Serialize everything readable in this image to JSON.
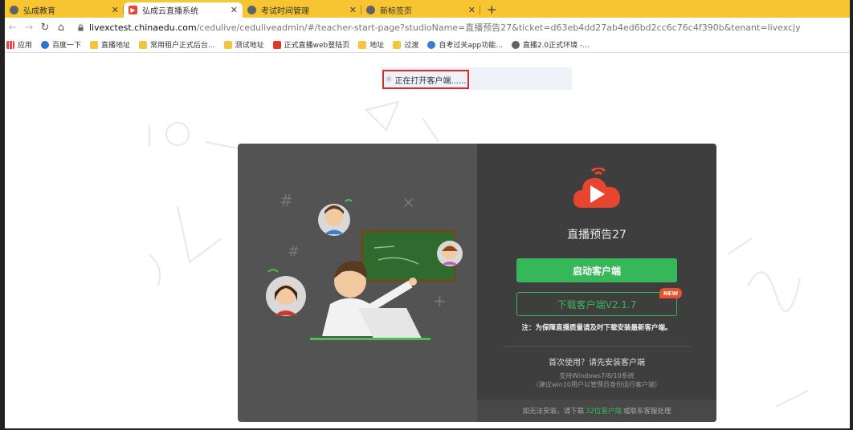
{
  "tabs": [
    {
      "title": "弘成教育",
      "favicon": "globe-icon",
      "active": false
    },
    {
      "title": "弘成云直播系统",
      "favicon": "live-app-icon",
      "active": true
    },
    {
      "title": "考试时间管理",
      "favicon": "globe-icon",
      "active": false
    },
    {
      "title": "新标签页",
      "favicon": "globe-icon",
      "active": false
    }
  ],
  "address": {
    "host": "livexctest.chinaedu.com",
    "path": "/cedulive/ceduliveadmin/#/teacher-start-page?studioName=直播预告27&ticket=d63eb4dd27ab4ed6bd2cc6c76c4f390b&tenant=livexcjy"
  },
  "bookmarks": [
    {
      "label": "应用",
      "icon": "apps-grid-icon"
    },
    {
      "label": "百度一下",
      "icon": "baidu-paw-icon"
    },
    {
      "label": "直播地址",
      "icon": "folder-icon"
    },
    {
      "label": "常用租户正式后台...",
      "icon": "folder-icon"
    },
    {
      "label": "测试地址",
      "icon": "folder-icon"
    },
    {
      "label": "正式直播web登陆页",
      "icon": "live-app-icon"
    },
    {
      "label": "地址",
      "icon": "folder-icon"
    },
    {
      "label": "过渡",
      "icon": "folder-icon"
    },
    {
      "label": "自考过关app功能...",
      "icon": "globe-icon"
    },
    {
      "label": "直播2.0正式环境 -...",
      "icon": "chrome-icon"
    }
  ],
  "status": {
    "text": "正在打开客户端......"
  },
  "dialog": {
    "studio_name": "直播预告27",
    "launch_label": "启动客户端",
    "download_label": "下载客户端V2.1.7",
    "new_badge": "NEW",
    "note": "注：为保障直播质量请及时下载安装最新客户端。",
    "first_use": "首次使用？请先安装客户端",
    "support_line1": "支持Windows7/8/10系统",
    "support_line2": "（建议win10用户以管理员身份运行客户端）",
    "footer_prefix": "如无法安装，请下载",
    "footer_link": "32位客户端",
    "footer_suffix": "或联系客服处理"
  },
  "colors": {
    "chrome_yellow": "#f7c531",
    "accent_green": "#36b85a",
    "brand_red": "#e8452e",
    "highlight_red": "#d92c2c"
  }
}
